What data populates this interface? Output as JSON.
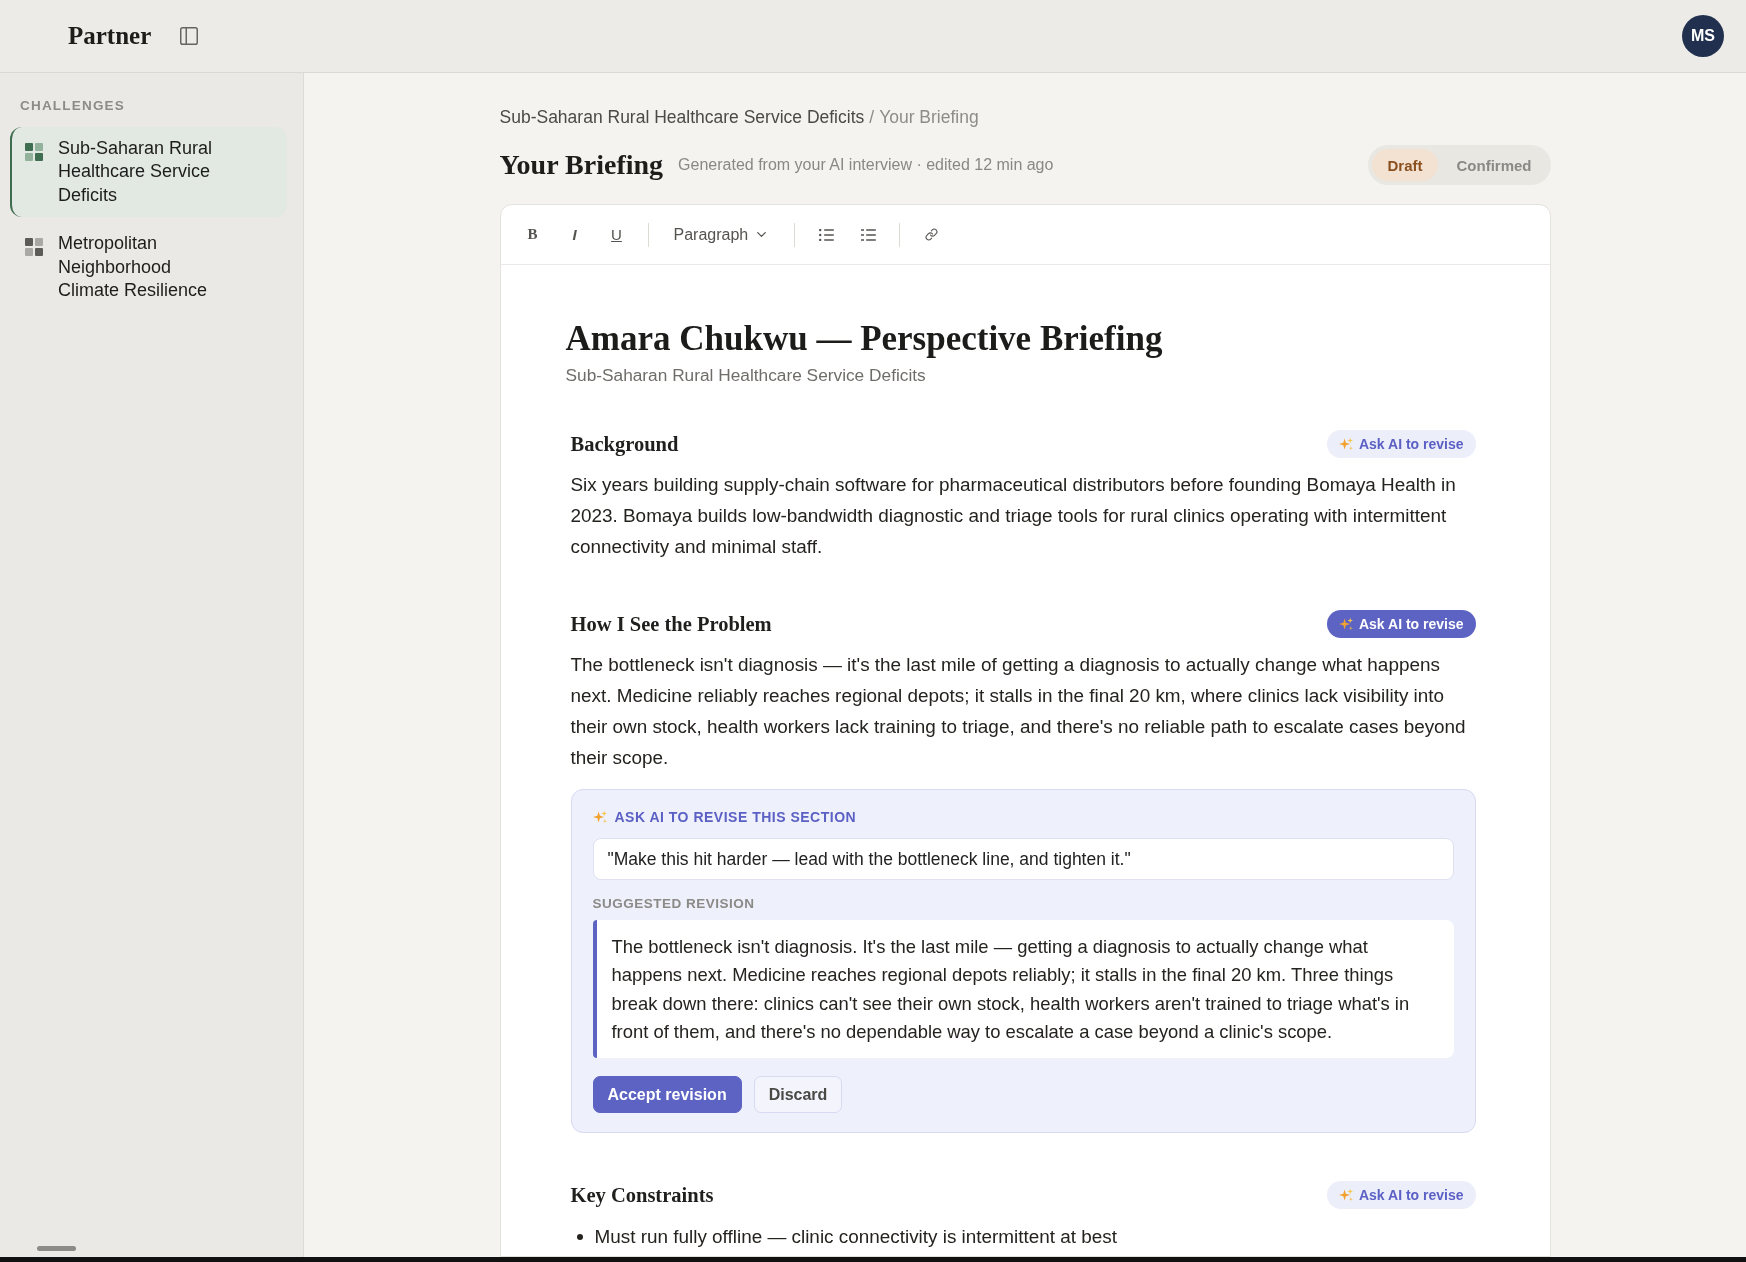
{
  "app": {
    "name": "Partner",
    "user_initials": "MS"
  },
  "sidebar": {
    "heading": "CHALLENGES",
    "items": [
      {
        "label": "Sub-Saharan Rural Healthcare Service Deficits",
        "selected": true
      },
      {
        "label": "Metropolitan Neighborhood Climate Resilience",
        "selected": false
      }
    ]
  },
  "breadcrumb": {
    "parent": "Sub-Saharan Rural Healthcare Service Deficits",
    "separator": "/",
    "current": "Your Briefing"
  },
  "header": {
    "title": "Your Briefing",
    "meta": "Generated from your AI interview · edited 12 min ago",
    "status_options": [
      {
        "label": "Draft",
        "selected": true
      },
      {
        "label": "Confirmed",
        "selected": false
      }
    ]
  },
  "editor": {
    "toolbar": [
      {
        "kind": "bold",
        "label": "B"
      },
      {
        "kind": "italic",
        "label": "I"
      },
      {
        "kind": "underline",
        "label": "U"
      },
      {
        "kind": "divider"
      },
      {
        "kind": "dropdown",
        "label": "Paragraph"
      },
      {
        "kind": "divider"
      },
      {
        "kind": "bullet-list"
      },
      {
        "kind": "dash-list"
      },
      {
        "kind": "divider"
      },
      {
        "kind": "link"
      }
    ]
  },
  "document": {
    "title": "Amara Chukwu — Perspective Briefing",
    "subtitle": "Sub-Saharan Rural Healthcare Service Deficits",
    "sections": [
      {
        "kind": "paragraph",
        "heading": "Background",
        "revise_button": {
          "label": "Ask AI to revise",
          "active": false
        },
        "body": "Six years building supply-chain software for pharmaceutical distributors before founding Bomaya Health in 2023. Bomaya builds low-bandwidth diagnostic and triage tools for rural clinics operating with intermittent connectivity and minimal staff."
      },
      {
        "kind": "paragraph",
        "heading": "How I See the Problem",
        "revise_button": {
          "label": "Ask AI to revise",
          "active": true
        },
        "body": "The bottleneck isn't diagnosis — it's the last mile of getting a diagnosis to actually change what happens next. Medicine reliably reaches regional depots; it stalls in the final 20 km, where clinics lack visibility into their own stock, health workers lack training to triage, and there's no reliable path to escalate cases beyond their scope.",
        "revision_panel": {
          "label": "ASK AI TO REVISE THIS SECTION",
          "prompt": "\"Make this hit harder — lead with the bottleneck line, and tighten it.\"",
          "suggestion_label": "SUGGESTED REVISION",
          "suggestion": "The bottleneck isn't diagnosis. It's the last mile — getting a diagnosis to actually change what happens next. Medicine reaches regional depots reliably; it stalls in the final 20 km. Three things break down there: clinics can't see their own stock, health workers aren't trained to triage what's in front of them, and there's no dependable way to escalate a case beyond a clinic's scope.",
          "actions": [
            {
              "kind": "primary",
              "label": "Accept revision"
            },
            {
              "kind": "secondary",
              "label": "Discard"
            }
          ]
        }
      },
      {
        "kind": "bullets",
        "heading": "Key Constraints",
        "revise_button": {
          "label": "Ask AI to revise",
          "active": false
        },
        "items": [
          "Must run fully offline — clinic connectivity is intermittent at best"
        ]
      }
    ]
  }
}
